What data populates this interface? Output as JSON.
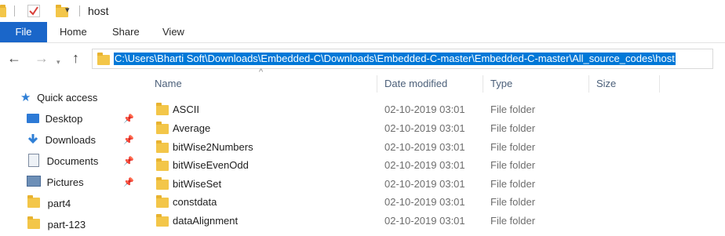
{
  "window": {
    "title": "host"
  },
  "quick_access_toolbar": {
    "customize_icon": "dropdown-arrow"
  },
  "ribbon": {
    "tabs": [
      {
        "label": "File"
      },
      {
        "label": "Home"
      },
      {
        "label": "Share"
      },
      {
        "label": "View"
      }
    ]
  },
  "navigation": {
    "back_icon": "←",
    "forward_icon": "→",
    "up_icon": "↑",
    "address_path": "C:\\Users\\Bharti Soft\\Downloads\\Embedded-C\\Downloads\\Embedded-C-master\\Embedded-C-master\\All_source_codes\\host"
  },
  "nav_pane": {
    "quick_access_label": "Quick access",
    "items": [
      {
        "label": "Desktop",
        "icon": "desktop-icon",
        "pinned": true
      },
      {
        "label": "Downloads",
        "icon": "download-icon",
        "pinned": true
      },
      {
        "label": "Documents",
        "icon": "documents-icon",
        "pinned": true
      },
      {
        "label": "Pictures",
        "icon": "pictures-icon",
        "pinned": true
      },
      {
        "label": "part4",
        "icon": "folder-icon",
        "pinned": false
      },
      {
        "label": "part-123",
        "icon": "folder-icon",
        "pinned": false
      }
    ]
  },
  "columns": {
    "name": "Name",
    "date": "Date modified",
    "type": "Type",
    "size": "Size"
  },
  "files": [
    {
      "name": "ASCII",
      "date": "02-10-2019 03:01",
      "type": "File folder"
    },
    {
      "name": "Average",
      "date": "02-10-2019 03:01",
      "type": "File folder"
    },
    {
      "name": "bitWise2Numbers",
      "date": "02-10-2019 03:01",
      "type": "File folder"
    },
    {
      "name": "bitWiseEvenOdd",
      "date": "02-10-2019 03:01",
      "type": "File folder"
    },
    {
      "name": "bitWiseSet",
      "date": "02-10-2019 03:01",
      "type": "File folder"
    },
    {
      "name": "constdata",
      "date": "02-10-2019 03:01",
      "type": "File folder"
    },
    {
      "name": "dataAlignment",
      "date": "02-10-2019 03:01",
      "type": "File folder"
    }
  ],
  "colors": {
    "accent": "#1a66c9",
    "selection": "#0078d7",
    "folder": "#f3c649"
  }
}
